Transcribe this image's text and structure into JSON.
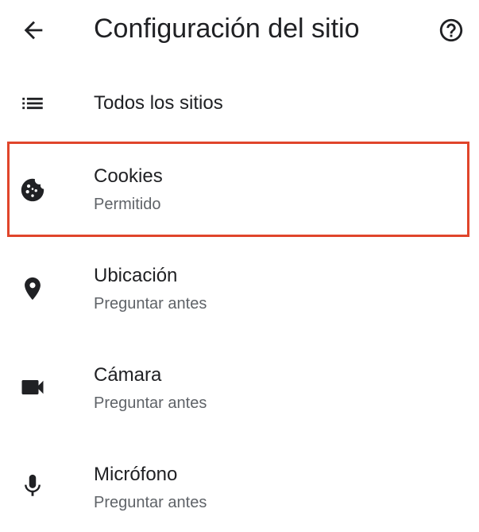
{
  "header": {
    "title": "Configuración del sitio",
    "back_icon": "arrow-back-icon",
    "help_icon": "help-circle-icon"
  },
  "items": [
    {
      "id": "all-sites",
      "icon": "list-icon",
      "label": "Todos los sitios"
    },
    {
      "id": "cookies",
      "icon": "cookie-icon",
      "label": "Cookies",
      "status": "Permitido",
      "highlighted": true
    },
    {
      "id": "location",
      "icon": "location-pin-icon",
      "label": "Ubicación",
      "status": "Preguntar antes"
    },
    {
      "id": "camera",
      "icon": "videocam-icon",
      "label": "Cámara",
      "status": "Preguntar antes"
    },
    {
      "id": "microphone",
      "icon": "mic-icon",
      "label": "Micrófono",
      "status": "Preguntar antes"
    }
  ],
  "colors": {
    "highlight_border": "#e0452b",
    "text_primary": "#202124",
    "text_secondary": "#5f6368"
  }
}
